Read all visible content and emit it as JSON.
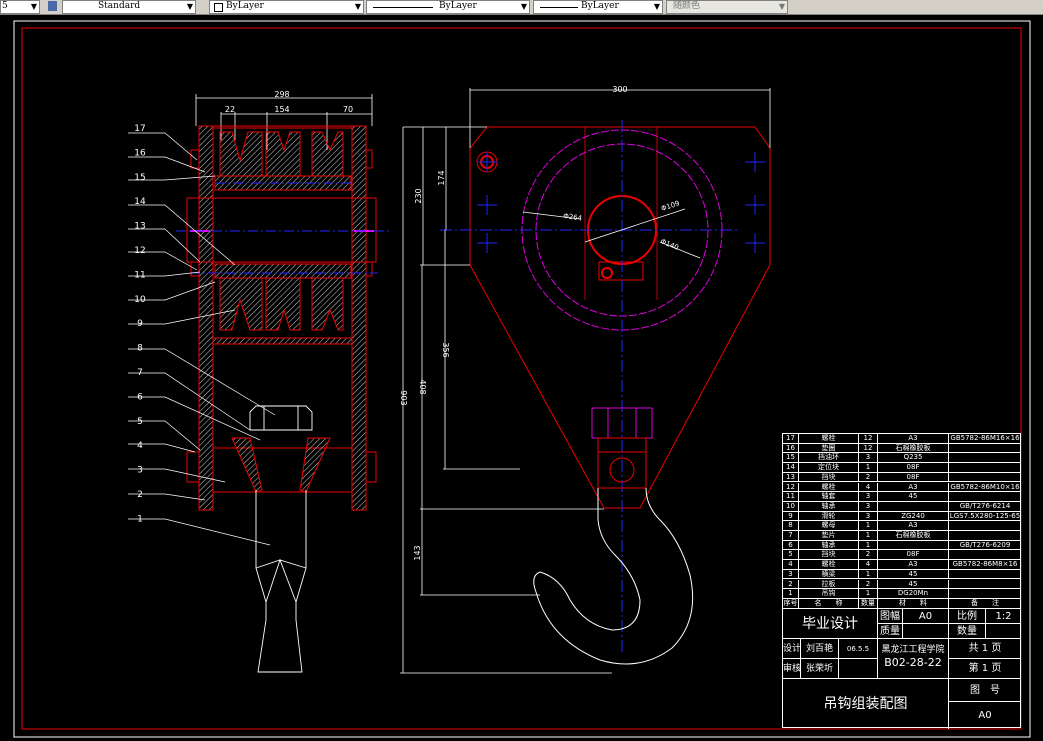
{
  "toolbar": {
    "layer_value": "5",
    "text_style": "Standard",
    "color": "ByLayer",
    "linetype": "ByLayer",
    "lineweight": "ByLayer",
    "plot_style": "随颜色"
  },
  "colors": {
    "background": "#000000",
    "outline": "#ff0000",
    "centerline": "#0000ff",
    "hidden": "#ff00ff",
    "dimension": "#ffffff"
  },
  "side_view": {
    "dimensions": {
      "overall_width": "298",
      "left": "22",
      "middle": "154",
      "right": "70"
    },
    "balloons": [
      "17",
      "16",
      "15",
      "14",
      "13",
      "12",
      "11",
      "10",
      "9",
      "8",
      "7",
      "6",
      "5",
      "4",
      "3",
      "2",
      "1"
    ]
  },
  "front_view": {
    "dimensions": {
      "width": "300",
      "h230": "230",
      "h174": "174",
      "d264": "Φ264",
      "d109": "Φ109",
      "d140": "Φ140",
      "h356": "356",
      "h408": "408",
      "h903": "903",
      "h143": "143"
    }
  },
  "parts_list": {
    "rows": [
      {
        "no": "17",
        "name": "螺栓",
        "qty": "12",
        "material": "A3",
        "note": "GB5782-86M16×16"
      },
      {
        "no": "16",
        "name": "垫圈",
        "qty": "12",
        "material": "石棉橡胶板",
        "note": ""
      },
      {
        "no": "15",
        "name": "挡油环",
        "qty": "3",
        "material": "Q235",
        "note": ""
      },
      {
        "no": "14",
        "name": "定位块",
        "qty": "1",
        "material": "08F",
        "note": ""
      },
      {
        "no": "13",
        "name": "挡块",
        "qty": "2",
        "material": "08F",
        "note": ""
      },
      {
        "no": "12",
        "name": "螺栓",
        "qty": "4",
        "material": "A3",
        "note": "GB5782-86M10×16"
      },
      {
        "no": "11",
        "name": "轴套",
        "qty": "3",
        "material": "45",
        "note": ""
      },
      {
        "no": "10",
        "name": "轴承",
        "qty": "3",
        "material": "",
        "note": "GB/T276-6214"
      },
      {
        "no": "9",
        "name": "滑轮",
        "qty": "3",
        "material": "ZG240",
        "note": "LGS7.5X280-125-65"
      },
      {
        "no": "8",
        "name": "螺母",
        "qty": "1",
        "material": "A3",
        "note": ""
      },
      {
        "no": "7",
        "name": "垫片",
        "qty": "1",
        "material": "石棉橡胶板",
        "note": ""
      },
      {
        "no": "6",
        "name": "轴承",
        "qty": "1",
        "material": "",
        "note": "GB/T276-6209"
      },
      {
        "no": "5",
        "name": "挡块",
        "qty": "2",
        "material": "08F",
        "note": ""
      },
      {
        "no": "4",
        "name": "螺栓",
        "qty": "4",
        "material": "A3",
        "note": "GB5782-86M8×16"
      },
      {
        "no": "3",
        "name": "横梁",
        "qty": "1",
        "material": "45",
        "note": ""
      },
      {
        "no": "2",
        "name": "拉板",
        "qty": "2",
        "material": "45",
        "note": ""
      },
      {
        "no": "1",
        "name": "吊钩",
        "qty": "1",
        "material": "DG20Mn",
        "note": ""
      }
    ],
    "header": {
      "no": "序号",
      "name": "名　　称",
      "qty": "数量",
      "material": "材　　料",
      "note": "备　　注"
    }
  },
  "title_block": {
    "project": "毕业设计",
    "sheet_size_label": "图幅",
    "sheet_size": "A0",
    "scale_label": "比例",
    "scale": "1:2",
    "mass_label": "质量",
    "quantity_label": "数量",
    "designer_label": "设计",
    "designer": "刘百艳",
    "date": "06.5.5",
    "reviewer_label": "审核",
    "reviewer": "张荣圻",
    "school": "黑龙江工程学院",
    "code": "B02-28-22",
    "total_pages": "共 1 页",
    "page": "第 1 页",
    "drawing_title": "吊钩组装配图",
    "drawing_no_label": "图　号",
    "drawing_no": "A0"
  }
}
